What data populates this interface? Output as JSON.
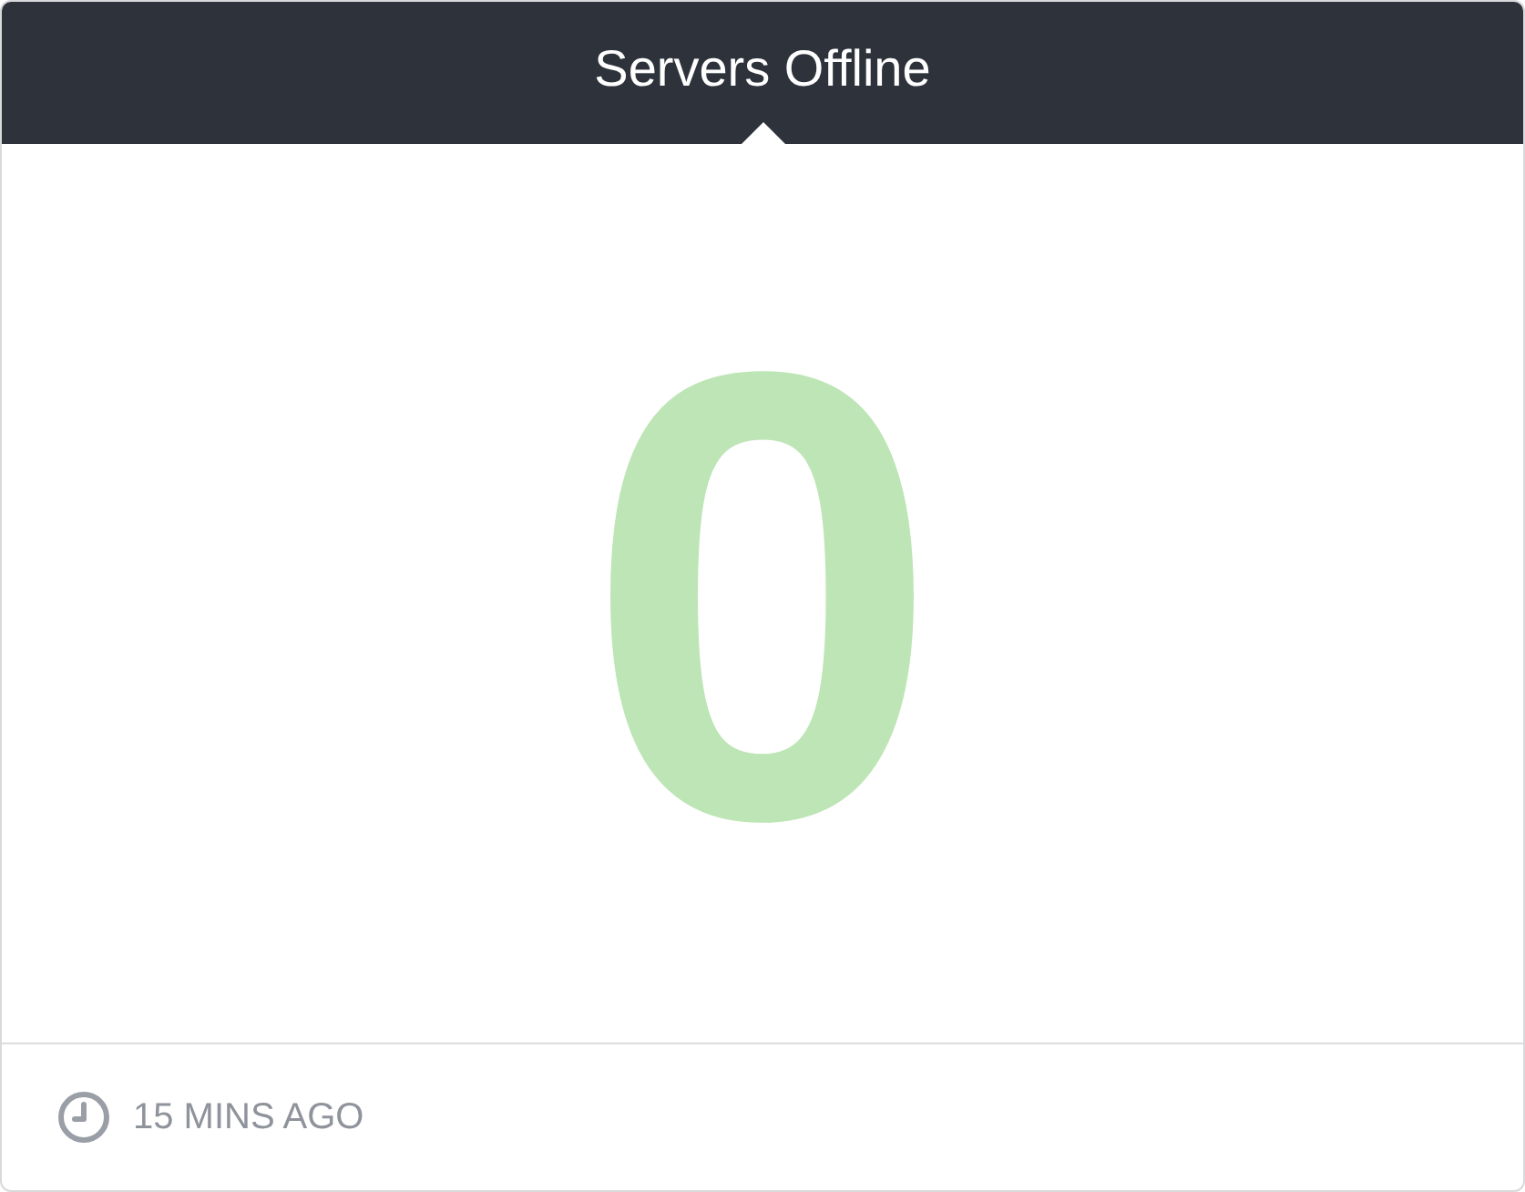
{
  "header": {
    "title": "Servers Offline"
  },
  "metric": {
    "value": "0"
  },
  "footer": {
    "updated": "15 MINS AGO"
  }
}
